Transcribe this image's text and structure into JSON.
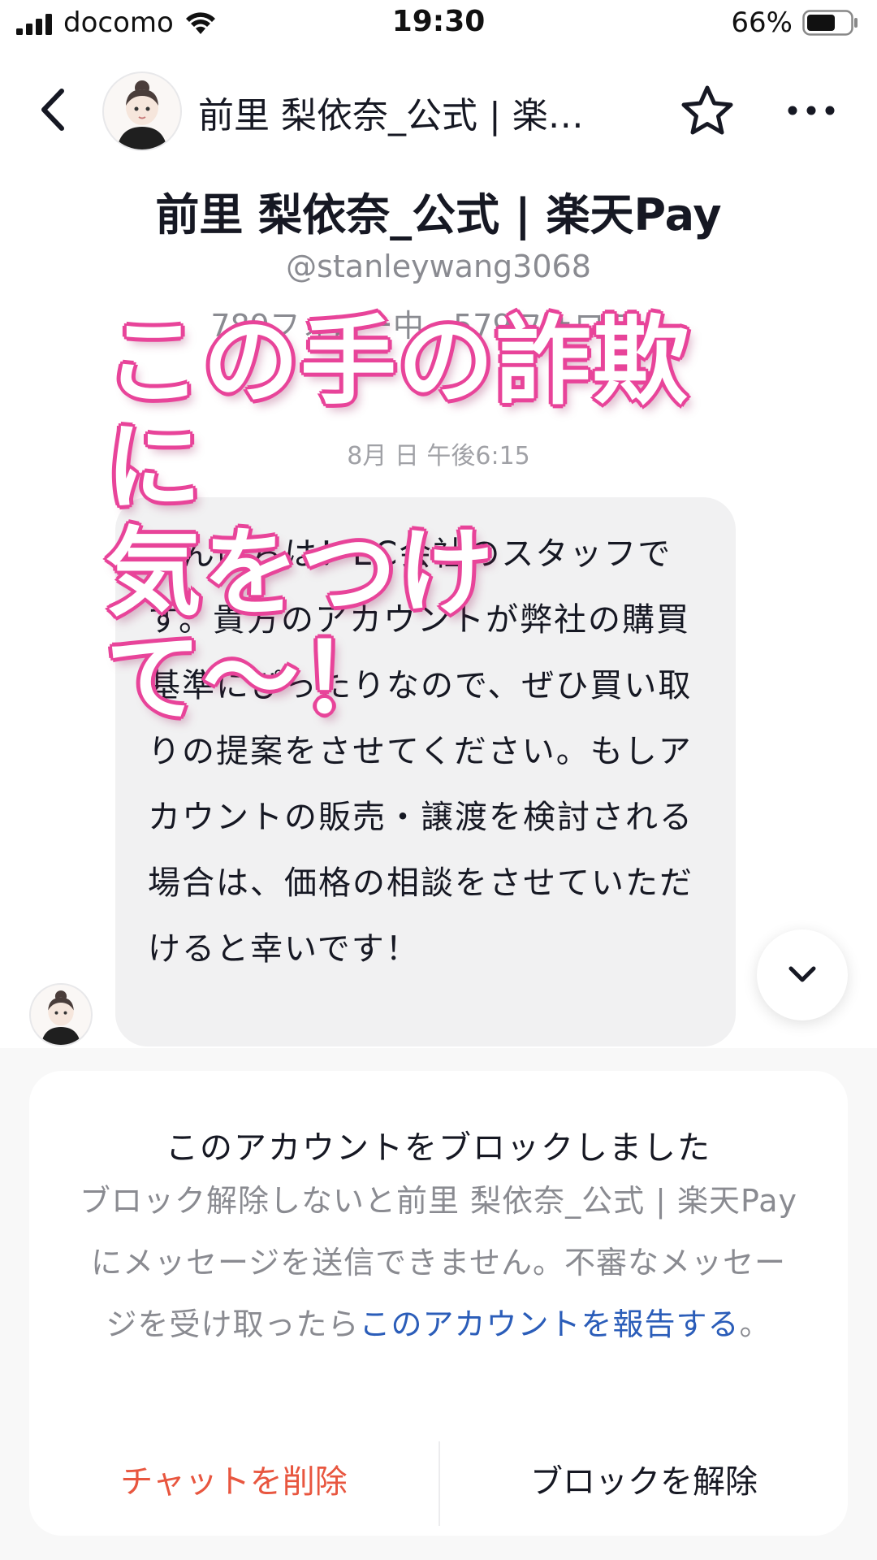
{
  "status_bar": {
    "carrier": "docomo",
    "time": "19:30",
    "battery": "66%",
    "battery_level": 0.66
  },
  "header": {
    "name": "前里 梨依奈_公式 | 楽…",
    "icons": [
      "back-chevron-icon",
      "star-icon",
      "more-dots-icon"
    ]
  },
  "profile": {
    "name": "前里 梨依奈_公式 | 楽天Pay",
    "handle": "@stanleywang3068",
    "follow_info": "789フォロー中 · 579フォロワー"
  },
  "message": {
    "timestamp": "8月 日 午後6:15",
    "text": "こんにちは！EC会社のスタッフです。貴方のアカウントが弊社の購買基準にぴったりなので、ぜひ買い取りの提案をさせてください。もしアカウントの販売・譲渡を検討される場合は、価格の相談をさせていただけると幸いです！"
  },
  "caption": {
    "line1": "この手の詐欺に",
    "line2": "気をつけて〜！",
    "color": "#e8459a"
  },
  "block_card": {
    "title": "このアカウントをブロックしました",
    "body": "ブロック解除しないと前里 梨依奈_公式 | 楽天Payにメッセージを送信できません。不審なメッセージを受け取ったら",
    "link": "このアカウントを報告する",
    "body_end": "。",
    "delete_label": "チャットを削除",
    "unblock_label": "ブロックを解除"
  },
  "colors": {
    "link": "#2b5db9",
    "delete": "#e8563f",
    "bubble": "#f1f1f2"
  }
}
